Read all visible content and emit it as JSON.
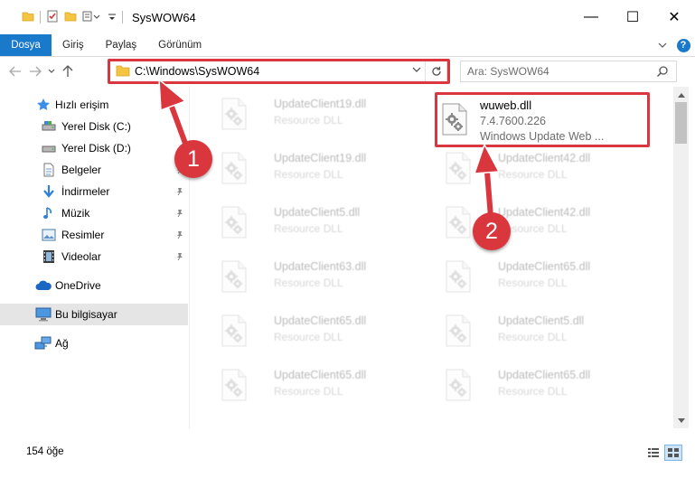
{
  "window": {
    "title": "SysWOW64",
    "minimize_glyph": "—",
    "maximize_glyph": "☐",
    "close_glyph": "✕"
  },
  "ribbon": {
    "tabs": [
      "Dosya",
      "Giriş",
      "Paylaş",
      "Görünüm"
    ],
    "help_glyph": "?"
  },
  "address": {
    "path": "C:\\Windows\\SysWOW64",
    "search_placeholder": "Ara: SysWOW64"
  },
  "sidebar": {
    "items": [
      {
        "label": "Hızlı erişim",
        "icon": "star-icon"
      },
      {
        "label": "Yerel Disk (C:)",
        "icon": "drive-icon"
      },
      {
        "label": "Yerel Disk (D:)",
        "icon": "drive-icon"
      },
      {
        "label": "Belgeler",
        "icon": "document-icon"
      },
      {
        "label": "İndirmeler",
        "icon": "download-icon"
      },
      {
        "label": "Müzik",
        "icon": "music-icon"
      },
      {
        "label": "Resimler",
        "icon": "picture-icon"
      },
      {
        "label": "Videolar",
        "icon": "video-icon"
      },
      {
        "label": "OneDrive",
        "icon": "cloud-icon"
      },
      {
        "label": "Bu bilgisayar",
        "icon": "computer-icon"
      },
      {
        "label": "Ağ",
        "icon": "network-icon"
      }
    ]
  },
  "files": {
    "left_column": [
      {
        "name": "UpdateClient19.dll",
        "type": "Resource DLL"
      },
      {
        "name": "UpdateClient19.dll",
        "type": "Resource DLL"
      },
      {
        "name": "UpdateClient5.dll",
        "type": "Resource DLL"
      },
      {
        "name": "UpdateClient63.dll",
        "type": "Resource DLL"
      },
      {
        "name": "UpdateClient65.dll",
        "type": "Resource DLL"
      },
      {
        "name": "UpdateClient65.dll",
        "type": "Resource DLL"
      }
    ],
    "right_column": [
      {
        "name": "UpdateClient42.dll",
        "type": "Resource DLL"
      },
      {
        "name": "UpdateClient42.dll",
        "type": "Resource DLL"
      },
      {
        "name": "UpdateClient65.dll",
        "type": "Resource DLL"
      },
      {
        "name": "UpdateClient5.dll",
        "type": "Resource DLL"
      },
      {
        "name": "UpdateClient65.dll",
        "type": "Resource DLL"
      }
    ],
    "target": {
      "name": "wuweb.dll",
      "version": "7.4.7600.226",
      "description": "Windows Update Web ..."
    }
  },
  "status": {
    "item_count": "154 öğe"
  },
  "callouts": [
    "1",
    "2"
  ],
  "colors": {
    "accent": "#1979ca",
    "highlight": "#d9363e"
  }
}
